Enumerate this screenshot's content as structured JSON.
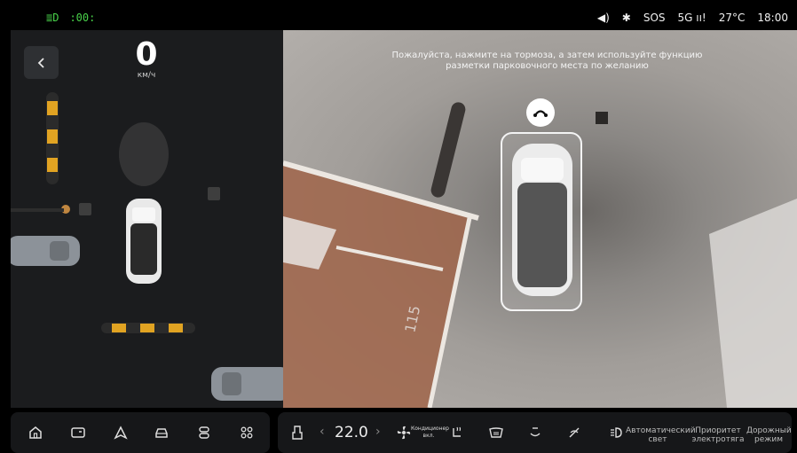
{
  "status": {
    "left_icons": [
      "headlight-icon",
      "parking-light-icon"
    ],
    "sos": "SOS",
    "network": "5G",
    "temperature": "27°C",
    "time": "18:00"
  },
  "speed": {
    "value": "0",
    "unit": "км/ч"
  },
  "camera": {
    "hint": "Пожалуйста, нажмите на тормоза, а затем используйте функцию разметки парковочного места по желанию",
    "floor_number": "115"
  },
  "climate": {
    "temperature": "22.0",
    "ac_label": "Кондиционер",
    "ac_state": "вкл.",
    "auto_light_line1": "Автоматический",
    "auto_light_line2": "свет",
    "ev_priority_line1": "Приоритет",
    "ev_priority_line2": "электротяга",
    "road_mode_line1": "Дорожный",
    "road_mode_line2": "режим"
  },
  "colors": {
    "accent_green": "#49d24a",
    "panel": "#1b1c1e",
    "bar": "#161719"
  }
}
